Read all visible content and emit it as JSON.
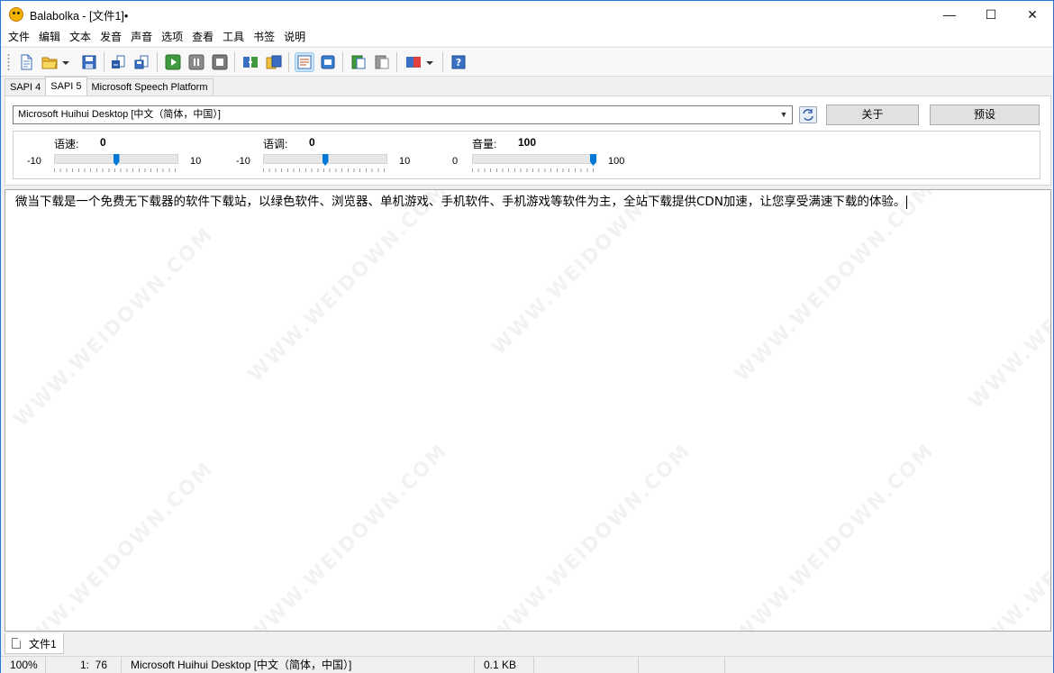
{
  "window": {
    "title": "Balabolka - [文件1]•",
    "minimize": "—",
    "maximize": "☐",
    "close": "✕"
  },
  "menu": [
    "文件",
    "编辑",
    "文本",
    "发音",
    "声音",
    "选项",
    "查看",
    "工具",
    "书签",
    "说明"
  ],
  "toolbar": {
    "buttons": [
      "new-file-icon",
      "open-file-icon",
      "open-dropdown-icon",
      "save-icon",
      "speak-file-icon",
      "save-audio-icon",
      "play-icon",
      "pause-icon",
      "stop-icon",
      "convert-icon",
      "batch-icon",
      "text-view-icon",
      "voice-view-icon",
      "clipboard-icon",
      "clipboard-reader-icon",
      "split-icon",
      "split-dropdown-icon",
      "help-icon"
    ]
  },
  "engine_tabs": [
    "SAPI 4",
    "SAPI 5",
    "Microsoft Speech Platform"
  ],
  "voice": {
    "selected": "Microsoft Huihui Desktop [中文（简体，中国）]",
    "about_button": "关于",
    "preset_button": "预设"
  },
  "sliders": {
    "rate": {
      "label": "语速:",
      "value": "0",
      "min": "-10",
      "max": "10",
      "level": 0.5
    },
    "pitch": {
      "label": "语调:",
      "value": "0",
      "min": "-10",
      "max": "10",
      "level": 0.5
    },
    "volume": {
      "label": "音量:",
      "value": "100",
      "min": "0",
      "max": "100",
      "level": 1.0
    }
  },
  "editor": {
    "text": "微当下载是一个免费无下载器的软件下载站，以绿色软件、浏览器、单机游戏、手机软件、手机游戏等软件为主，全站下载提供CDN加速，让您享受满速下载的体验。",
    "watermark": "WWW.WEIDOWN.COM"
  },
  "doc_tab": "文件1",
  "status": {
    "zoom": "100%",
    "position": "1:  76",
    "voice": "Microsoft Huihui Desktop [中文（简体，中国）]",
    "size": "0.1 KB"
  },
  "colors": {
    "accent": "#0078d7",
    "title_border": "#2b79d7"
  }
}
